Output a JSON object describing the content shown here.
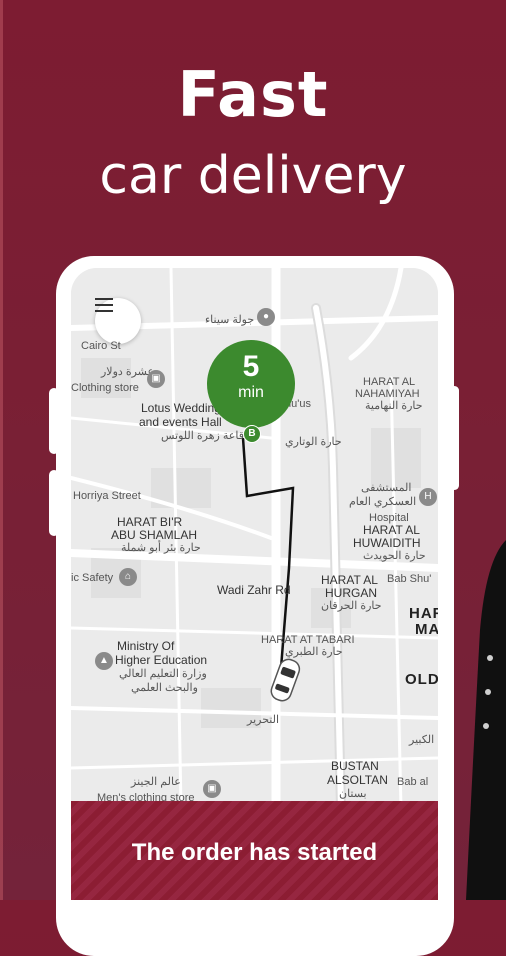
{
  "hero": {
    "title": "Fast",
    "subtitle": "car delivery"
  },
  "map": {
    "eta_value": "5",
    "eta_unit": "min",
    "destination_marker": "B",
    "labels": {
      "cairo_st": "Cairo St",
      "clothing_store_ar": "عشرة دولار",
      "clothing_store": "Clothing store",
      "lotus": "Lotus Wedding",
      "lotus2": "and events Hall",
      "lotus_ar": "قاعة زهرة اللوتس",
      "harat_al_nahamiyah": "HARAT AL",
      "harat_al_nahamiyah2": "NAHAMIYAH",
      "harat_al_nahamiyah_ar": "حارة النهامية",
      "harat_al_watari_ar": "حارة الوتاري",
      "hospital_ar": "المستشفى",
      "hospital_ar2": "العسكري العام",
      "hospital": "Hospital",
      "harat_bir": "HARAT BI'R",
      "harat_bir2": "ABU SHAMLAH",
      "harat_bir_ar": "حارة بئر أبو شملة",
      "harat_al_huwaidith": "HARAT AL",
      "harat_al_huwaidith2": "HUWAIDITH",
      "harat_al_huwaidith_ar": "حارة الحويدث",
      "wadi_zahr": "Wadi Zahr Rd",
      "harat_al_hurgan": "HARAT AL",
      "harat_al_hurgan2": "HURGAN",
      "harat_al_hurgan_ar": "حارة الحرقان",
      "bab_shu": "Bab Shu'",
      "harat_ma": "HAR",
      "harat_ma2": "MA",
      "safety": "ic Safety",
      "ministry": "Ministry Of",
      "ministry2": "Higher Education",
      "ministry_ar": "وزارة التعليم العالي",
      "ministry_ar2": "والبحث العلمي",
      "harat_at_tabari": "HARAT AT TABARI",
      "harat_at_tabari_ar": "حارة الطبري",
      "tahrir_ar": "التحرير",
      "old": "OLD",
      "bustan": "BUSTAN",
      "bustan2": "ALSOLTAN",
      "bustan_ar": "بستان",
      "bab_al": "Bab al",
      "kabir_ar": "الكبير",
      "mens_store_ar": "عالم الجينز",
      "mens_store": "Men's clothing store",
      "horriya": "Horriya Street",
      "sinai_ar": "جولة سيناء",
      "hu_us": "hu'us"
    }
  },
  "banner": {
    "text": "The order has started"
  },
  "colors": {
    "brand": "#7d1c32",
    "eta_green": "#3c8a2e"
  }
}
